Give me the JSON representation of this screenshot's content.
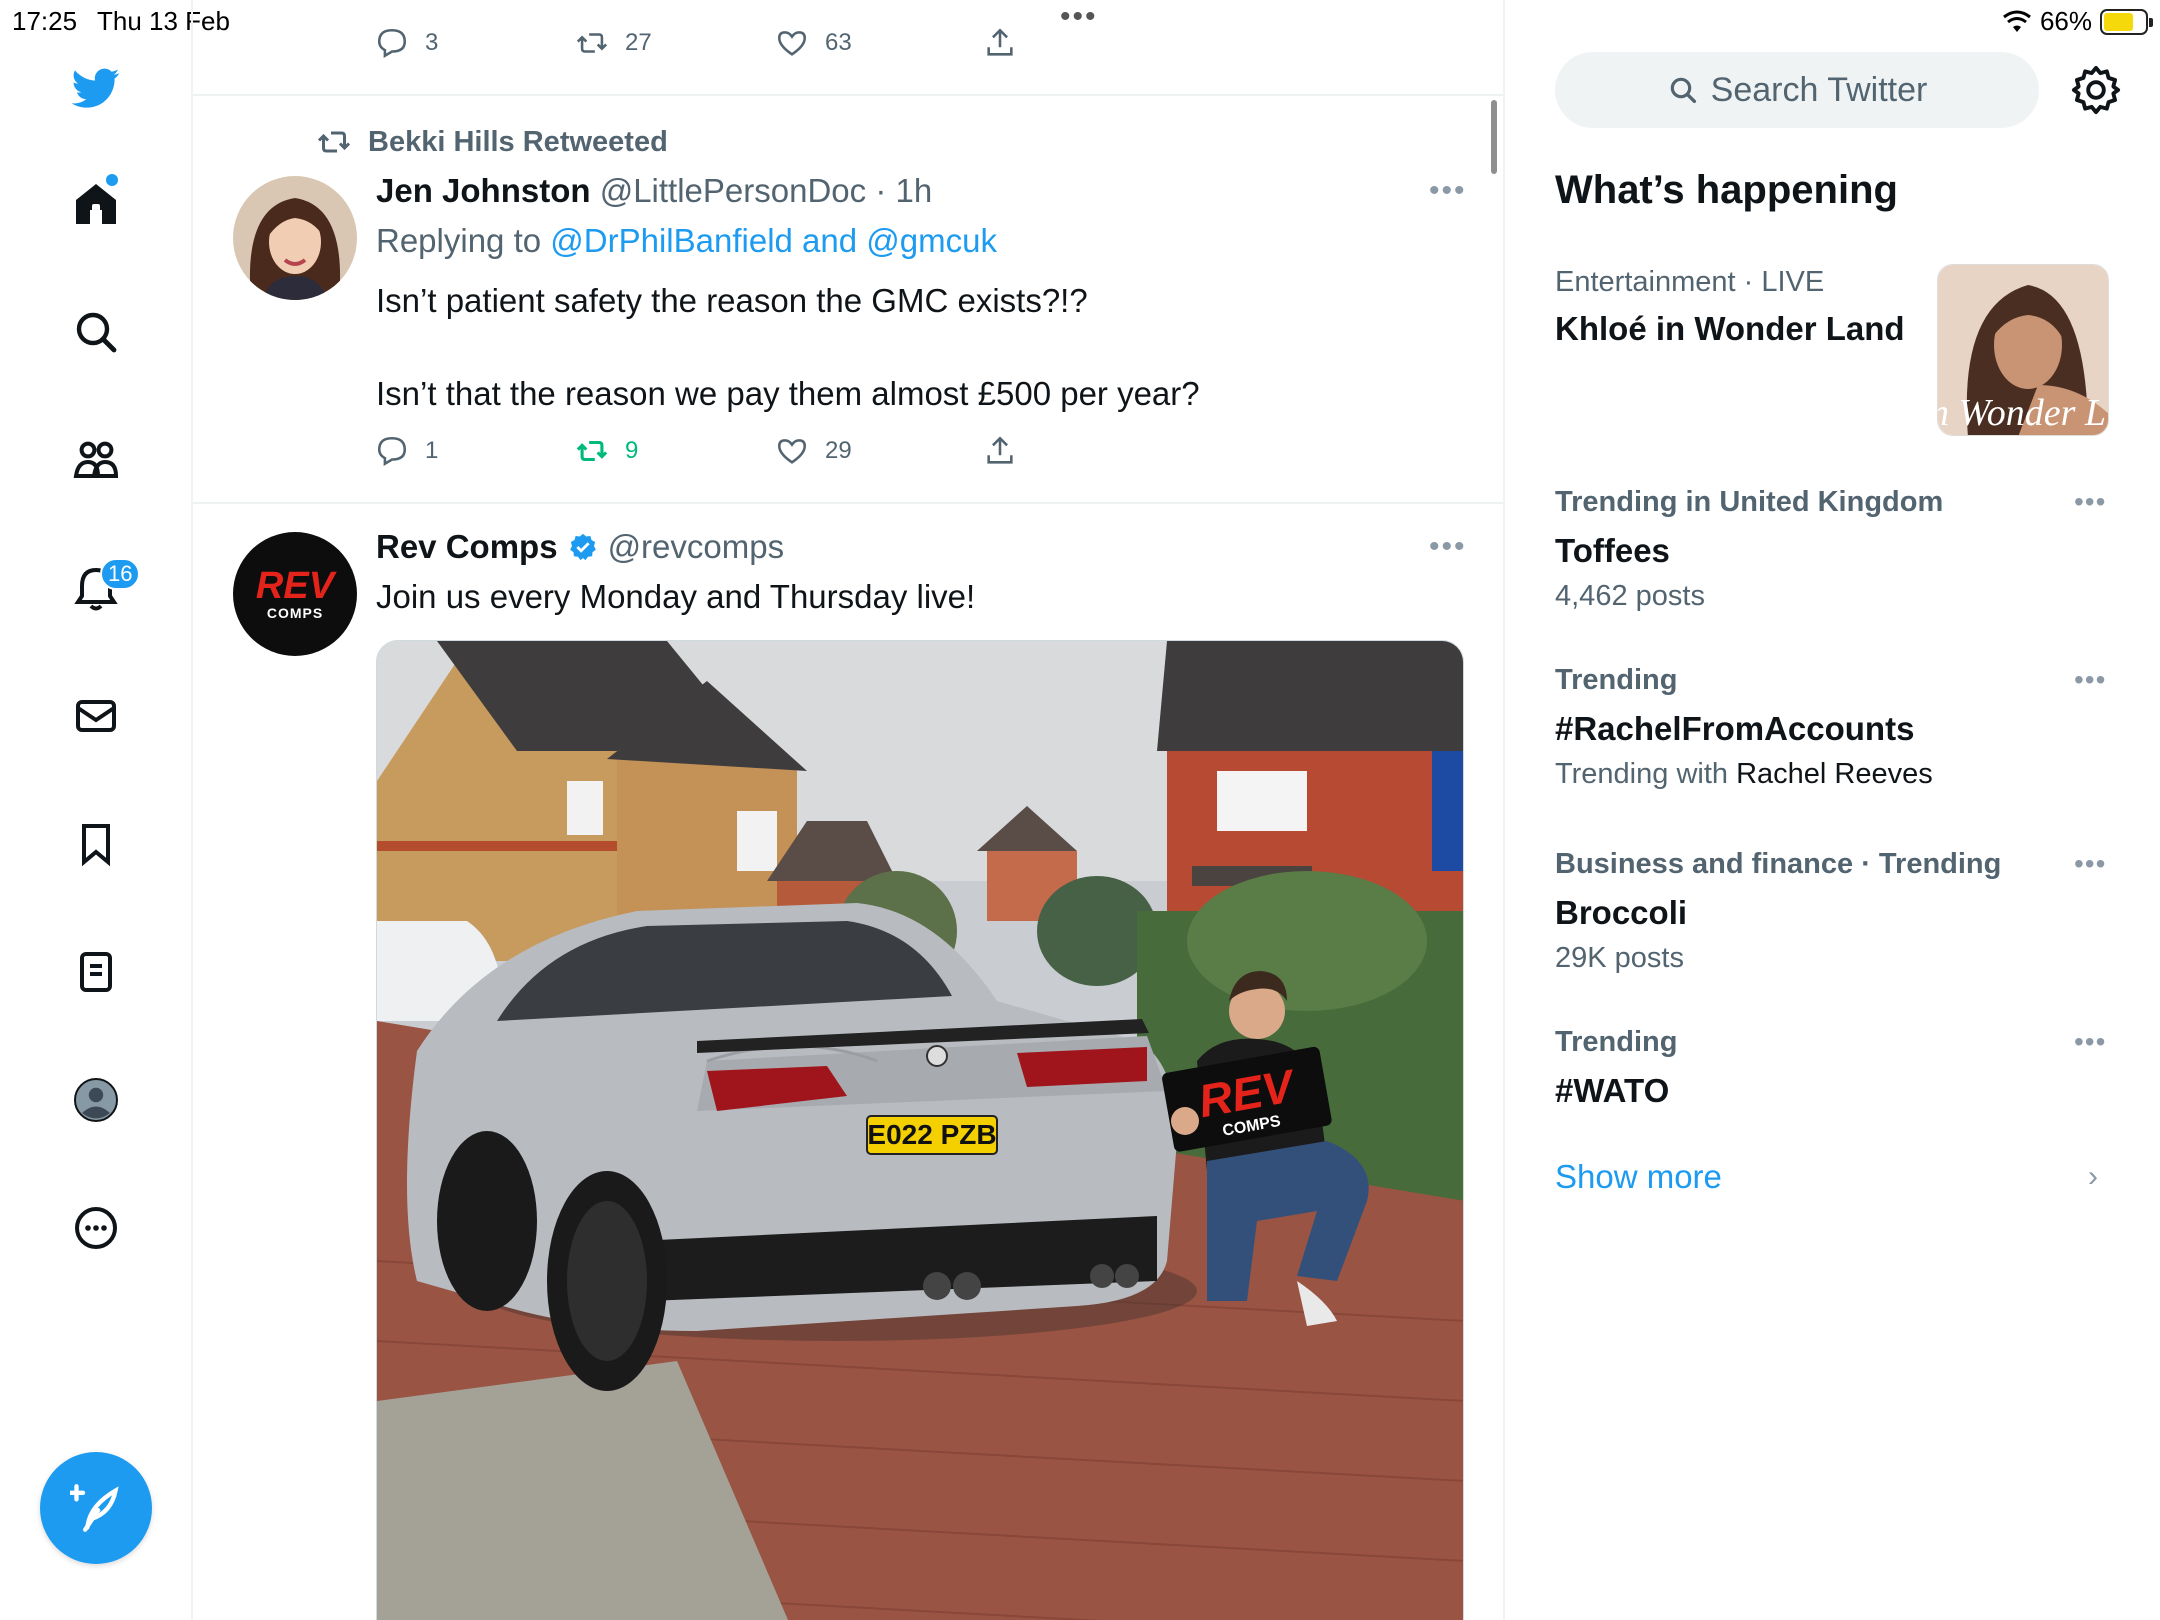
{
  "status_bar": {
    "time": "17:25",
    "date": "Thu 13 Feb",
    "battery_percent": "66%",
    "battery_level": 0.66
  },
  "nav": {
    "items": [
      "home-icon",
      "explore-icon",
      "communities-icon",
      "notifications-icon",
      "messages-icon",
      "bookmarks-icon",
      "lists-icon",
      "profile-icon",
      "more-icon"
    ],
    "notifications_badge": "16"
  },
  "prev_tweet": {
    "replies": "3",
    "retweets": "27",
    "likes": "63"
  },
  "tweet1": {
    "retweeted_by": "Bekki Hills Retweeted",
    "name": "Jen Johnston",
    "handle": "@LittlePersonDoc",
    "time": "· 1h",
    "replying_prefix": "Replying to",
    "replying_to": "@DrPhilBanfield and @gmcuk",
    "text_line1": "Isn’t patient safety the reason the GMC exists?!?",
    "text_line2": "Isn’t that the reason we pay them almost £500 per year?",
    "replies": "1",
    "retweets": "9",
    "likes": "29"
  },
  "tweet2": {
    "name": "Rev Comps",
    "handle": "@revcomps",
    "text": "Join us every Monday and Thursday live!",
    "avatar_text": "REV",
    "avatar_sub": "COMPS",
    "plate": "E022 PZB",
    "banner_text": "REV",
    "banner_sub": "COMPS"
  },
  "sidebar": {
    "search_placeholder": "Search Twitter",
    "heading": "What’s happening",
    "trends": [
      {
        "meta": "Entertainment · LIVE",
        "title": "Khloé in Wonder Land",
        "image_caption": "é in Wonder L"
      },
      {
        "meta": "Trending in United Kingdom",
        "title": "Toffees",
        "sub": "4,462 posts"
      },
      {
        "meta": "Trending",
        "title": "#RachelFromAccounts",
        "sub_prefix": "Trending with",
        "sub_name": "Rachel Reeves"
      },
      {
        "meta": "Business and finance · Trending",
        "title": "Broccoli",
        "sub": "29K posts"
      },
      {
        "meta": "Trending",
        "title": "#WATO"
      }
    ],
    "show_more": "Show more"
  },
  "colors": {
    "accent": "#1d9bf0",
    "retweet_green": "#00ba7c",
    "muted": "#536471"
  }
}
